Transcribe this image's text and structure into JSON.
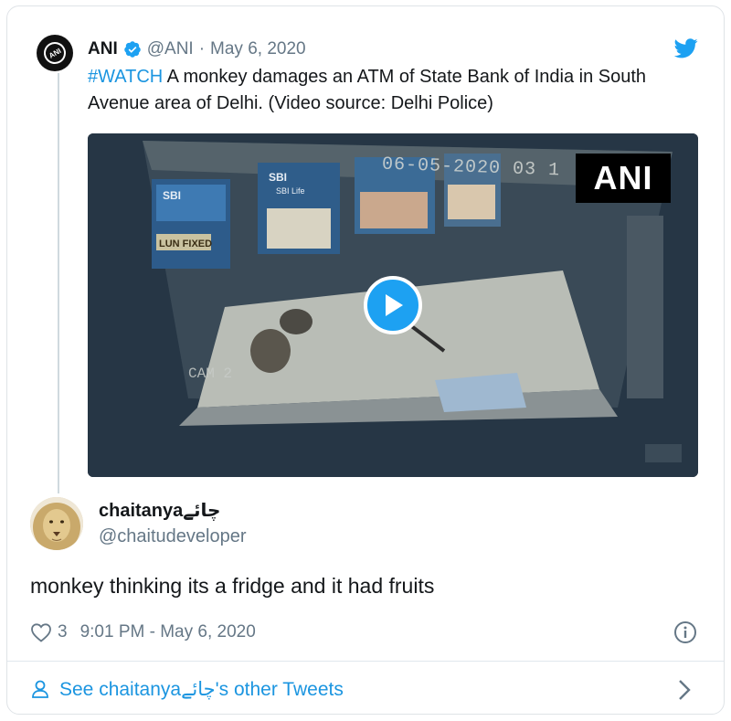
{
  "quoted_tweet": {
    "author_name": "ANI",
    "handle": "@ANI",
    "separator": "·",
    "date": "May 6, 2020",
    "hashtag": "#WATCH",
    "text": " A monkey damages an ATM of State Bank of India in South Avenue area of Delhi. (Video source: Delhi Police)",
    "avatar_text": "ANI"
  },
  "video": {
    "timestamp_overlay": "06-05-2020 03 1",
    "camera_label": "CAM 2",
    "watermark": "ANI",
    "poster_texts": [
      "SBI",
      "SBI",
      "SBI Life",
      "LUN FIXED"
    ]
  },
  "reply": {
    "author_name": "chaitanyaچائے",
    "handle": "@chaitudeveloper",
    "text": "monkey thinking its a fridge and it had fruits",
    "like_count": "3",
    "timestamp": "9:01 PM - May 6, 2020"
  },
  "footer": {
    "link_text": "See chaitanyaچائے's other Tweets"
  },
  "colors": {
    "twitter_blue": "#1da1f2",
    "link_blue": "#1b95e0",
    "muted_text": "#657786",
    "border": "#e1e8ed"
  },
  "icons": {
    "verified": "verified-badge-icon",
    "brand": "twitter-bird-icon",
    "play": "play-icon",
    "like": "heart-icon",
    "info": "info-icon",
    "profile": "person-icon",
    "next": "chevron-right-icon"
  }
}
